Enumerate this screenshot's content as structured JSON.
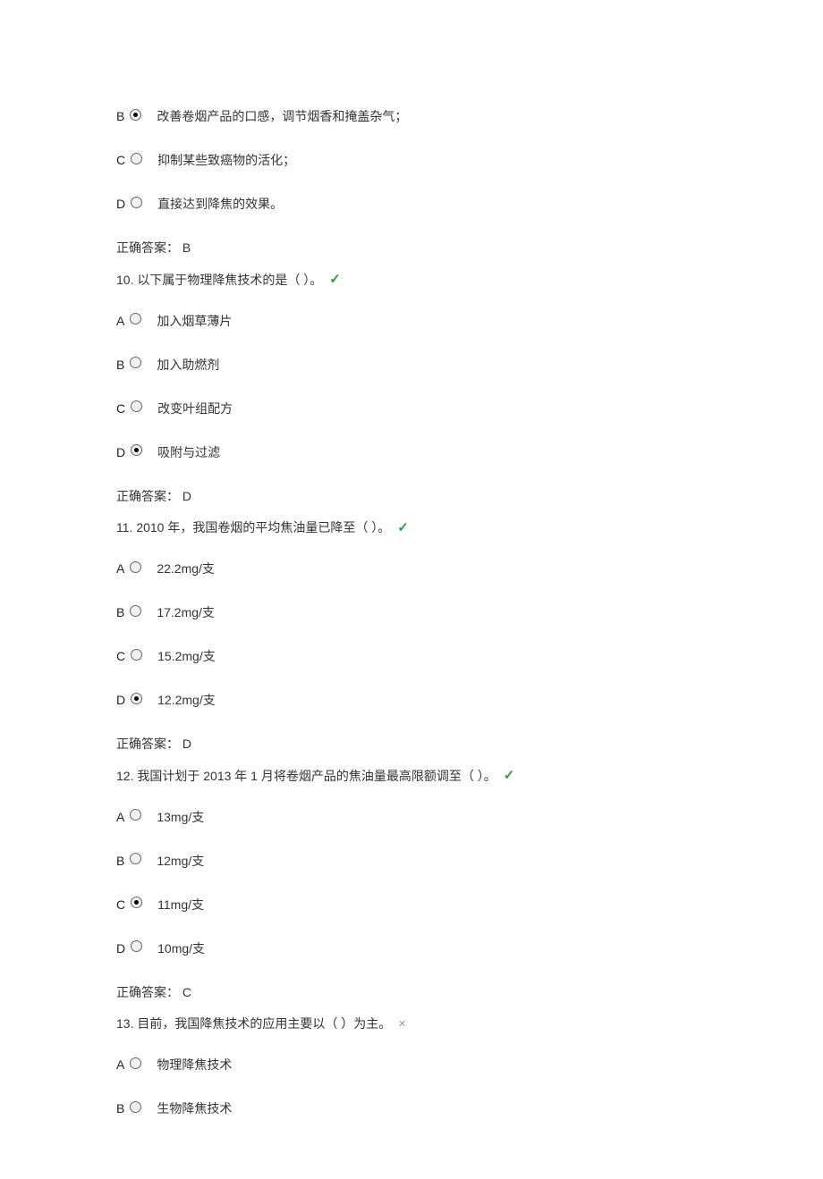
{
  "q9_partial": {
    "options": [
      {
        "letter": "B",
        "text": "改善卷烟产品的口感，调节烟香和掩盖杂气；",
        "selected": true
      },
      {
        "letter": "C",
        "text": "抑制某些致癌物的活化；",
        "selected": false
      },
      {
        "letter": "D",
        "text": "直接达到降焦的效果。",
        "selected": false
      }
    ],
    "answer": "正确答案：  B"
  },
  "q10": {
    "prompt": "10. 以下属于物理降焦技术的是（ ）。",
    "mark": "✓",
    "options": [
      {
        "letter": "A",
        "text": "加入烟草薄片",
        "selected": false
      },
      {
        "letter": "B",
        "text": "加入助燃剂",
        "selected": false
      },
      {
        "letter": "C",
        "text": "改变叶组配方",
        "selected": false
      },
      {
        "letter": "D",
        "text": "吸附与过滤",
        "selected": true
      }
    ],
    "answer": "正确答案：  D"
  },
  "q11": {
    "prompt": "11. 2010 年，我国卷烟的平均焦油量已降至（ ）。",
    "mark": "✓",
    "options": [
      {
        "letter": "A",
        "text": "22.2mg/支",
        "selected": false
      },
      {
        "letter": "B",
        "text": "17.2mg/支",
        "selected": false
      },
      {
        "letter": "C",
        "text": "15.2mg/支",
        "selected": false
      },
      {
        "letter": "D",
        "text": "12.2mg/支",
        "selected": true
      }
    ],
    "answer": "正确答案：  D"
  },
  "q12": {
    "prompt": "12. 我国计划于 2013 年 1 月将卷烟产品的焦油量最高限额调至（ ）。",
    "mark": "✓",
    "options": [
      {
        "letter": "A",
        "text": "13mg/支",
        "selected": false
      },
      {
        "letter": "B",
        "text": "12mg/支",
        "selected": false
      },
      {
        "letter": "C",
        "text": "11mg/支",
        "selected": true
      },
      {
        "letter": "D",
        "text": "10mg/支",
        "selected": false
      }
    ],
    "answer": "正确答案：  C"
  },
  "q13": {
    "prompt": "13. 目前，我国降焦技术的应用主要以（ ）为主。",
    "mark": "×",
    "options": [
      {
        "letter": "A",
        "text": "物理降焦技术",
        "selected": false
      },
      {
        "letter": "B",
        "text": "生物降焦技术",
        "selected": false
      }
    ]
  }
}
